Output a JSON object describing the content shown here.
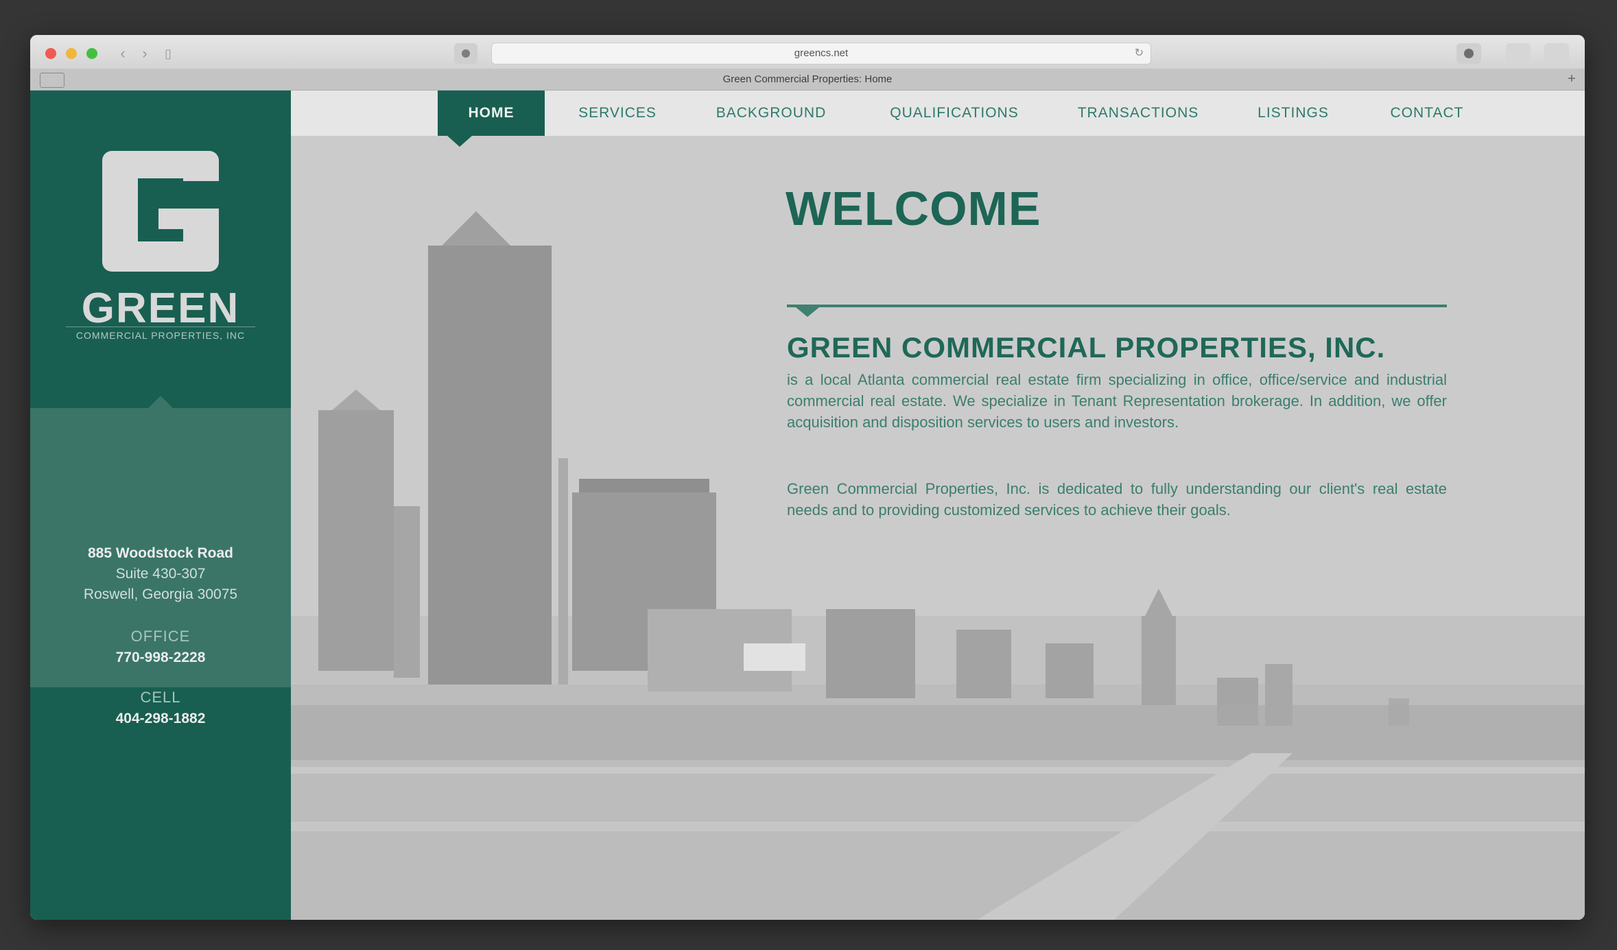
{
  "browser": {
    "url": "greencs.net",
    "tab_title": "Green Commercial Properties: Home"
  },
  "brand": {
    "name": "GREEN",
    "tagline": "COMMERCIAL PROPERTIES, INC",
    "color": "#185f51"
  },
  "contact": {
    "street": "885 Woodstock Road",
    "suite": "Suite 430-307",
    "city": "Roswell, Georgia 30075",
    "office_label": "OFFICE",
    "office_phone": "770-998-2228",
    "cell_label": "CELL",
    "cell_phone": "404-298-1882"
  },
  "nav": {
    "items": [
      "HOME",
      "SERVICES",
      "BACKGROUND",
      "QUALIFICATIONS",
      "TRANSACTIONS",
      "LISTINGS",
      "CONTACT"
    ],
    "active": "HOME"
  },
  "main": {
    "heading": "WELCOME",
    "company": "GREEN COMMERCIAL PROPERTIES, INC.",
    "para1": "is a local Atlanta commercial real estate firm specializing in office, office/service and industrial commercial real estate. We specialize in Tenant Representation brokerage. In addition, we offer acquisition and disposition services to users and investors.",
    "para2": "Green Commercial Properties, Inc. is dedicated to fully understanding our client's real estate needs and to providing customized services to achieve their goals."
  }
}
